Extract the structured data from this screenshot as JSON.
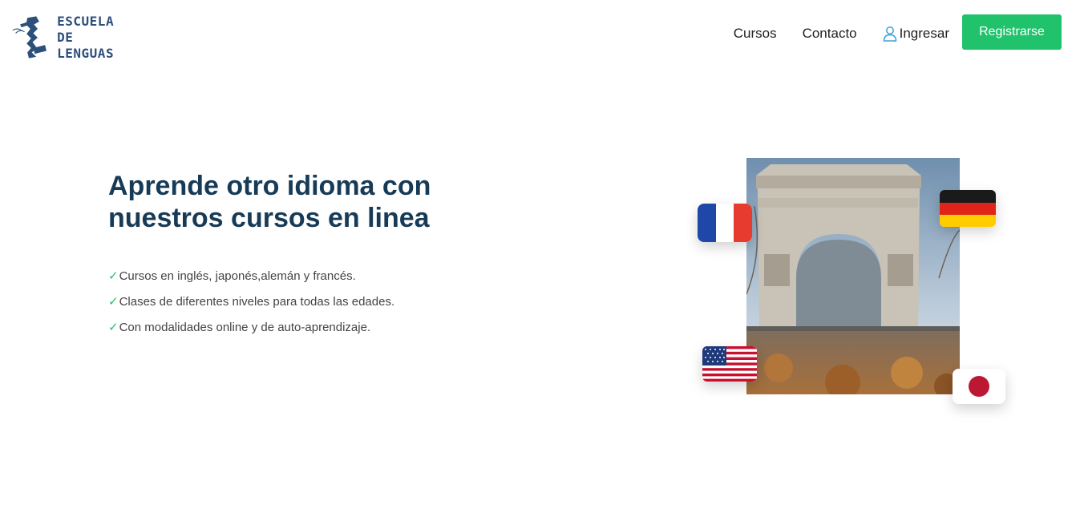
{
  "brand": {
    "line1": "ESCUELA",
    "line2": "DE LENGUAS"
  },
  "nav": {
    "courses": "Cursos",
    "contact": "Contacto",
    "login": "Ingresar",
    "register": "Registrarse"
  },
  "hero": {
    "title": "Aprende otro idioma con nuestros cursos en linea",
    "features": [
      "Cursos en inglés, japonés,alemán y francés.",
      "Clases de diferentes niveles para todas las edades.",
      "Con modalidades online y de auto-aprendizaje."
    ],
    "check_symbol": "✓"
  },
  "colors": {
    "accent": "#20c26b",
    "title": "#173b57",
    "brand": "#2d4f7c"
  },
  "icons": [
    "user-icon",
    "check-icon",
    "france-flag-icon",
    "germany-flag-icon",
    "usa-flag-icon",
    "japan-flag-icon"
  ]
}
